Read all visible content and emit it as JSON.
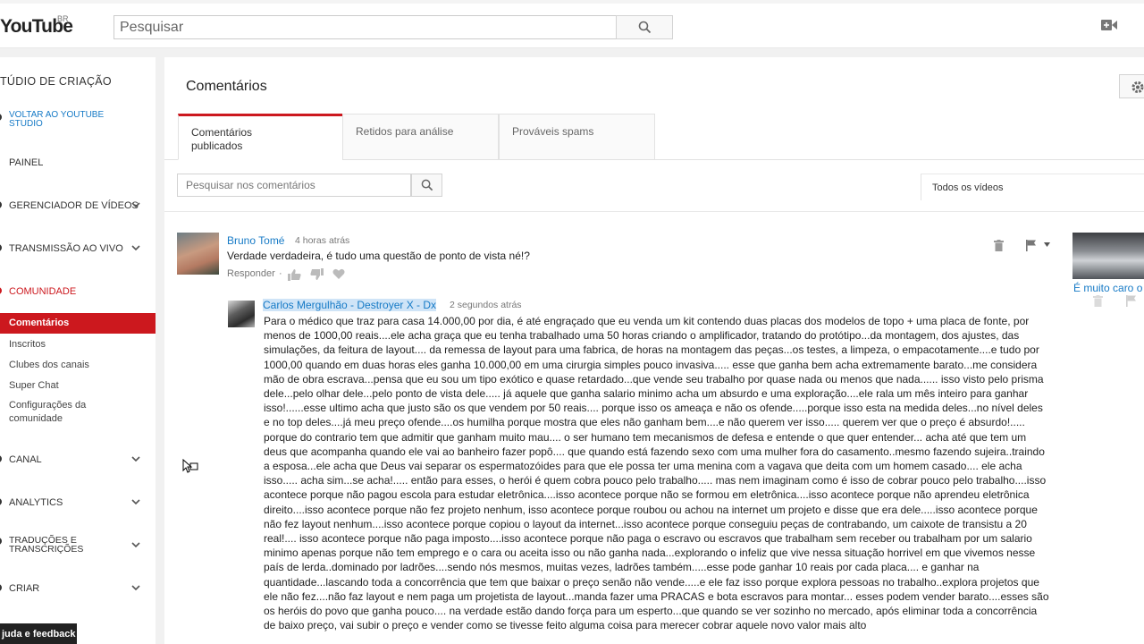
{
  "header": {
    "logo": "YouTube",
    "region": "BR",
    "search_placeholder": "Pesquisar"
  },
  "sidebar": {
    "title": "TÚDIO DE CRIAÇÃO",
    "back_link": "VOLTAR AO YOUTUBE STUDIO",
    "items": {
      "painel": "PAINEL",
      "videos": "GERENCIADOR DE VÍDEOS",
      "live": "TRANSMISSÃO AO VIVO",
      "comunidade": "COMUNIDADE",
      "canal": "CANAL",
      "analytics": "ANALYTICS",
      "traducoes": "TRADUÇÕES E TRANSCRIÇÕES",
      "criar": "CRIAR"
    },
    "community_sub": {
      "comentarios": "Comentários",
      "inscritos": "Inscritos",
      "clubes": "Clubes dos canais",
      "superchat": "Super Chat",
      "config": "Configurações da comunidade"
    },
    "help": "juda e feedback"
  },
  "main": {
    "title": "Comentários",
    "tabs": {
      "published": "Comentários publicados",
      "held": "Retidos para análise",
      "spam": "Prováveis spams"
    },
    "search_placeholder": "Pesquisar nos comentários",
    "filter": "Todos os vídeos"
  },
  "comments": {
    "first": {
      "author": "Bruno Tomé",
      "time": "4 horas atrás",
      "text": "Verdade verdadeira,  é tudo uma questão de ponto de vista né!?",
      "reply": "Responder",
      "separator": "·"
    },
    "reply": {
      "author": "Carlos Mergulhão - Destroyer X - Dx",
      "time": "2 segundos atrás",
      "text": "Para o médico que traz para casa 14.000,00 por dia, é até engraçado que eu venda um kit contendo duas placas dos modelos de topo + uma placa de fonte, por menos de 1000,00 reais....ele acha graça que eu tenha trabalhado uma 50 horas criando o amplificador, tratando do protótipo...da montagem, dos ajustes, das simulações, da feitura de layout.... da remessa de layout para uma fabrica, de horas na montagem das peças...os testes, a limpeza, o empacotamente....e tudo por 1000,00 quando em duas horas eles ganha 10.000,00 em uma cirurgia simples pouco invasiva..... esse que ganha bem acha extremamente barato...me considera mão de obra escrava...pensa que eu sou um tipo exótico e quase retardado...que vende seu trabalho por quase nada ou menos que nada...... isso visto pelo prisma dele...pelo olhar dele...pelo ponto de vista dele..... já aquele que ganha salario minimo acha um absurdo e uma exploração....ele rala um mês inteiro para ganhar isso!......esse ultimo acha que justo são os que vendem por 50 reais.... porque isso os ameaça e não os ofende.....porque isso esta na medida deles...no nível deles e no top deles....já meu preço ofende....os humilha porque mostra que eles não ganham bem....e não querem ver isso..... querem ver que o preço é absurdo!..... porque do contrario tem que admitir que ganham muito mau.... o ser humano tem mecanismos de defesa e entende o que quer entender... acha até que tem um deus que acompanha quando ele vai ao banheiro fazer popô.... que quando está fazendo sexo com uma mulher fora do casamento..mesmo fazendo sujeira..traindo a esposa...ele acha que Deus vai separar os espermatozóides para que ele possa ter uma menina com a vagava que deita com um homem casado.... ele acha isso..... acha sim...se acha!..... então para esses, o herói é quem cobra pouco pelo trabalho..... mas nem imaginam como é isso de cobrar pouco pelo trabalho....isso acontece porque não pagou escola para estudar eletrônica....isso acontece porque não se formou em eletrônica....isso acontece porque não aprendeu eletrônica direito....isso acontece porque não fez projeto nenhum,  isso acontece porque roubou ou achou na internet um projeto e disse que era dele.....isso acontece porque não fez layout nenhum....isso acontece porque copiou o layout da internet...isso acontece porque conseguiu peças de contrabando, um caixote de transistu a 20 real!.... isso acontece porque não paga imposto....isso acontece porque não paga o escravo ou escravos que trabalham sem receber ou trabalham por um salario minimo apenas porque não tem emprego e o cara ou aceita isso ou não ganha nada...explorando o infeliz que vive nessa situação horrivel em que vivemos nesse país de lerda..dominado por ladrões....sendo nós mesmos, muitas vezes, ladrões também.....esse pode ganhar 10 reais por cada placa.... e ganhar na quantidade...lascando toda a concorrência que tem que baixar o preço senão não vende.....e ele faz isso porque explora pessoas no trabalho..explora projetos que ele não fez....não faz layout e nem paga um projetista de layout...manda fazer uma PRACAS e bota escravos para montar... esses podem vender barato....esses são os heróis do povo que ganha pouco.... na verdade estão dando força para um esperto...que quando se ver sozinho no mercado, após eliminar toda a concorrência de baixo preço, vai subir o preço e vender como se tivesse feito alguma coisa para merecer cobrar aquele novo valor mais alto"
    }
  },
  "side_video": {
    "caption": "É muito caro o"
  },
  "colors": {
    "accent_red": "#cc181e",
    "link_blue": "#167ac6"
  }
}
